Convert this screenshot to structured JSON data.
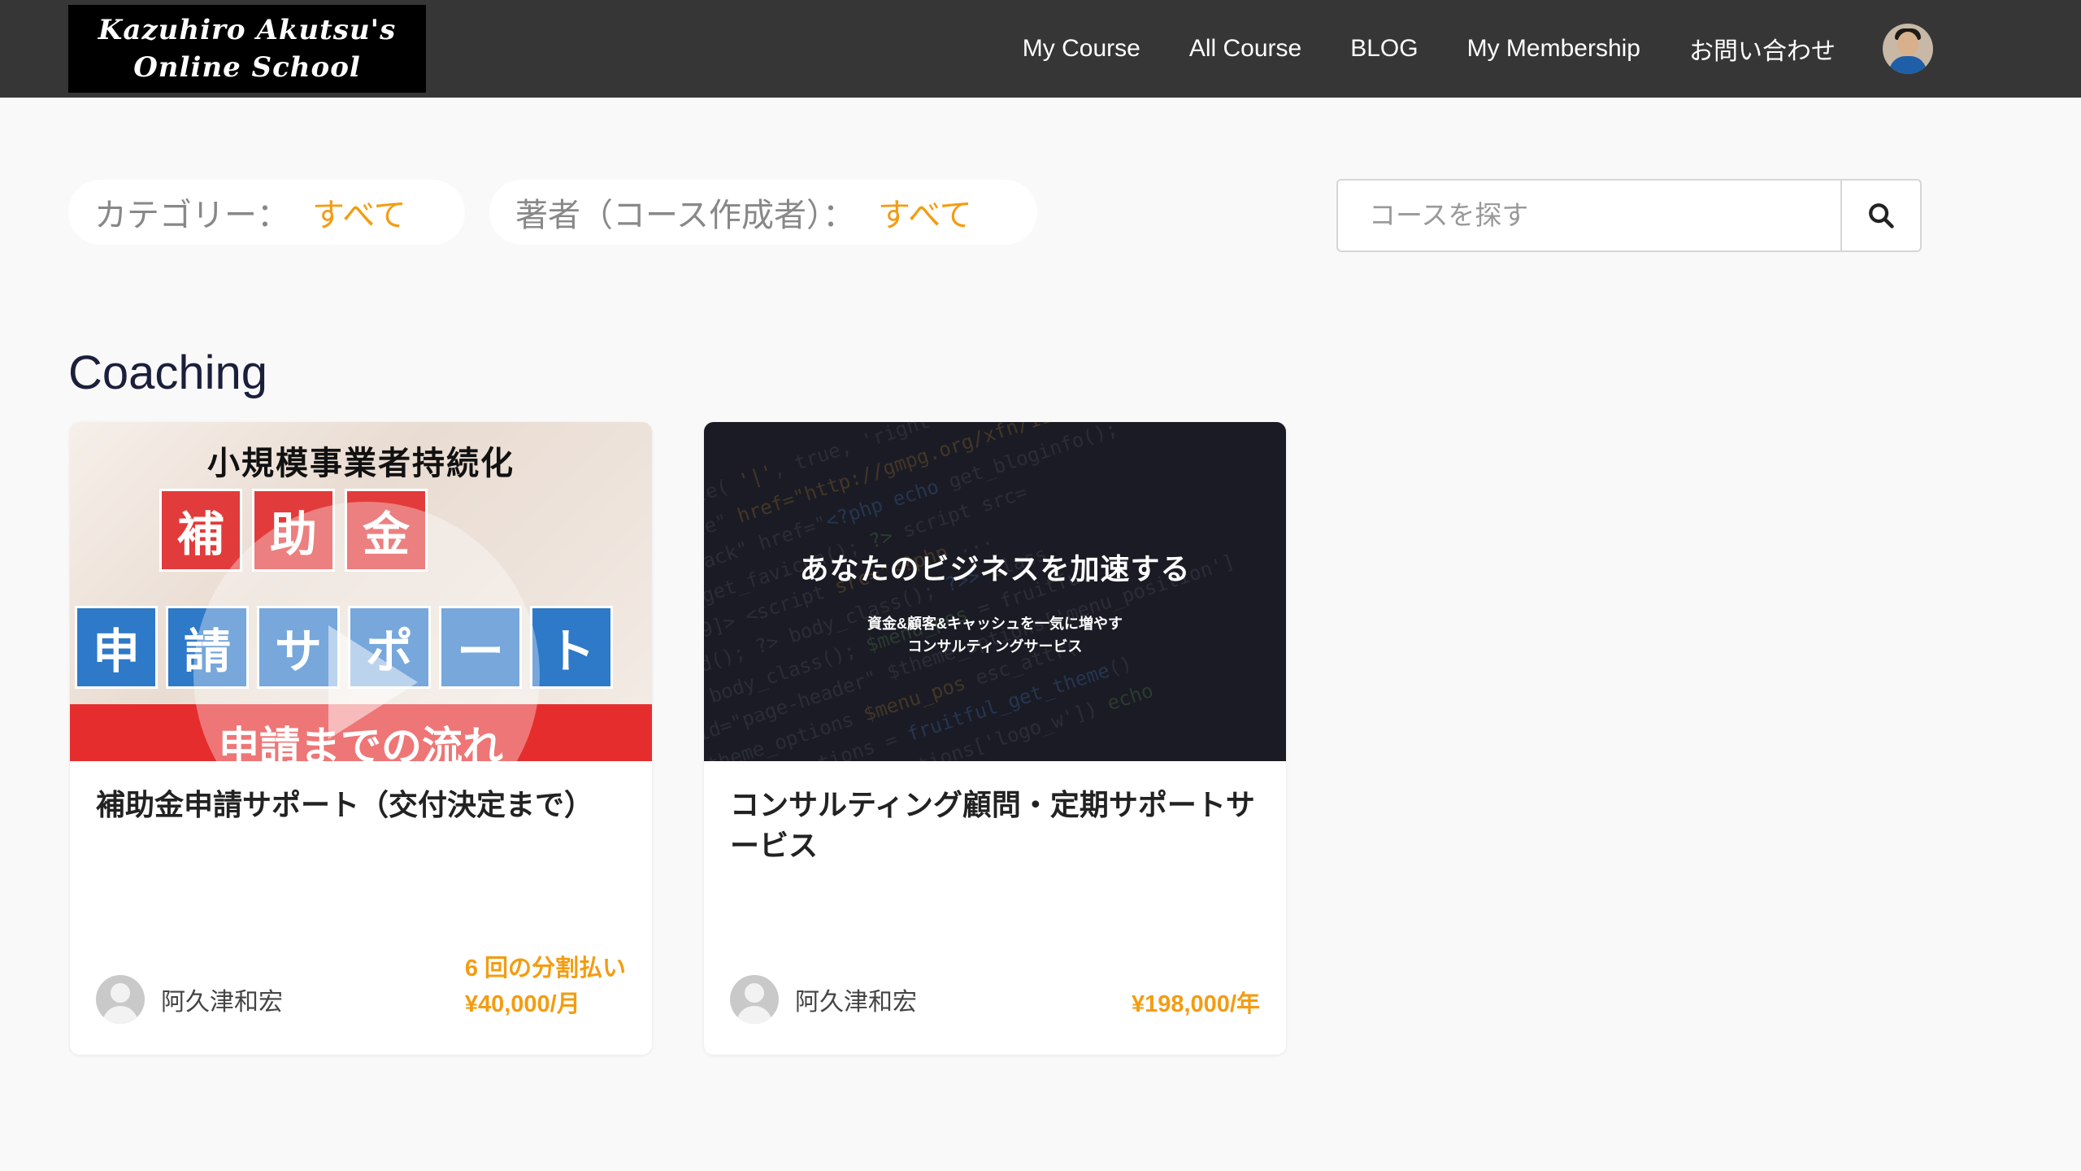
{
  "header": {
    "logo_line1": "Kazuhiro Akutsu's",
    "logo_line2": "Online School",
    "nav": [
      "My Course",
      "All Course",
      "BLOG",
      "My Membership",
      "お問い合わせ"
    ]
  },
  "filters": {
    "category_label": "カテゴリー：",
    "category_value": "すべて",
    "author_label": "著者（コース作成者）：",
    "author_value": "すべて"
  },
  "search": {
    "placeholder": "コースを探す"
  },
  "section_title": "Coaching",
  "courses": [
    {
      "thumb": {
        "title": "小規模事業者持続化",
        "row1": [
          "補",
          "助",
          "金"
        ],
        "row2": [
          "申",
          "請",
          "サ",
          "ポ",
          "ー",
          "ト"
        ],
        "band": "申請までの流れ"
      },
      "title": "補助金申請サポート（交付決定まで）",
      "author": "阿久津和宏",
      "price_line1": "6 回の分割払い",
      "price_line2": "¥40,000/月"
    },
    {
      "thumb": {
        "headline": "あなたのビジネスを加速する",
        "sub_line1": "資金&顧客&キャッシュを一気に増やす",
        "sub_line2": "コンサルティングサービス"
      },
      "title": "コンサルティング顧問・定期サポートサービス",
      "author": "阿久津和宏",
      "price_line1": "",
      "price_line2": "¥198,000/年"
    }
  ],
  "colors": {
    "header_bg": "#363636",
    "accent": "#f39c12",
    "title_text": "#1b1f3b"
  },
  "icons": {
    "search": "search-icon",
    "avatar": "user-avatar"
  }
}
